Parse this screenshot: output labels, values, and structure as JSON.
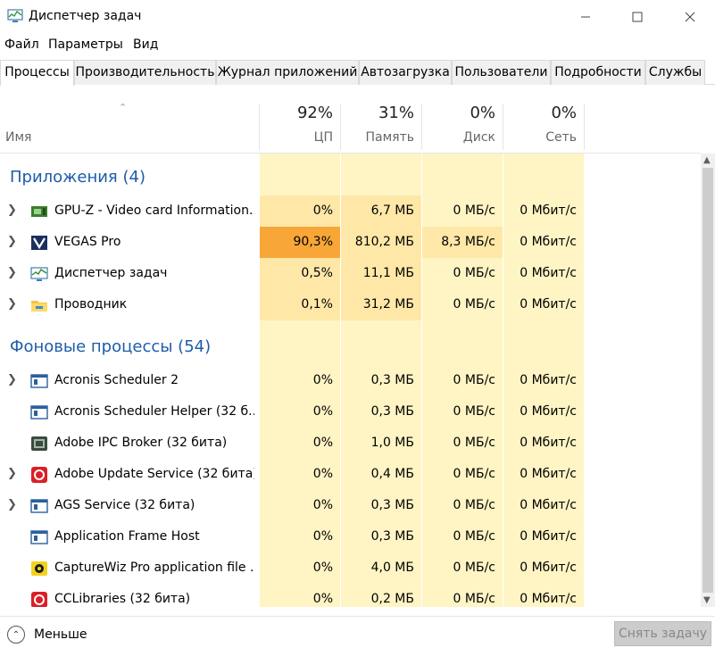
{
  "window": {
    "title": "Диспетчер задач"
  },
  "menu": [
    "Файл",
    "Параметры",
    "Вид"
  ],
  "tabs": [
    "Процессы",
    "Производительность",
    "Журнал приложений",
    "Автозагрузка",
    "Пользователи",
    "Подробности",
    "Службы"
  ],
  "columns": {
    "name": "Имя",
    "cpu": {
      "pct": "92%",
      "label": "ЦП"
    },
    "mem": {
      "pct": "31%",
      "label": "Память"
    },
    "disk": {
      "pct": "0%",
      "label": "Диск"
    },
    "net": {
      "pct": "0%",
      "label": "Сеть"
    }
  },
  "groups": [
    {
      "title": "Приложения (4)"
    },
    {
      "title": "Фоновые процессы (54)"
    }
  ],
  "rows": [
    {
      "name": "GPU-Z - Video card Information...",
      "cpu": "0%",
      "mem": "6,7 МБ",
      "disk": "0 МБ/с",
      "net": "0 Мбит/с",
      "icon": "gpu-card-icon"
    },
    {
      "name": "VEGAS Pro",
      "cpu": "90,3%",
      "mem": "810,2 МБ",
      "disk": "8,3 МБ/с",
      "net": "0 Мбит/с",
      "icon": "vegas-icon"
    },
    {
      "name": "Диспетчер задач",
      "cpu": "0,5%",
      "mem": "11,1 МБ",
      "disk": "0 МБ/с",
      "net": "0 Мбит/с",
      "icon": "task-manager-icon"
    },
    {
      "name": "Проводник",
      "cpu": "0,1%",
      "mem": "31,2 МБ",
      "disk": "0 МБ/с",
      "net": "0 Мбит/с",
      "icon": "folder-icon"
    },
    {
      "name": "Acronis Scheduler 2",
      "cpu": "0%",
      "mem": "0,3 МБ",
      "disk": "0 МБ/с",
      "net": "0 Мбит/с",
      "icon": "app-window-icon"
    },
    {
      "name": "Acronis Scheduler Helper (32 б...",
      "cpu": "0%",
      "mem": "0,3 МБ",
      "disk": "0 МБ/с",
      "net": "0 Мбит/с",
      "icon": "app-window-icon"
    },
    {
      "name": "Adobe IPC Broker (32 бита)",
      "cpu": "0%",
      "mem": "1,0 МБ",
      "disk": "0 МБ/с",
      "net": "0 Мбит/с",
      "icon": "adobe-ipc-icon"
    },
    {
      "name": "Adobe Update Service (32 бита)",
      "cpu": "0%",
      "mem": "0,4 МБ",
      "disk": "0 МБ/с",
      "net": "0 Мбит/с",
      "icon": "adobe-cc-icon"
    },
    {
      "name": "AGS Service (32 бита)",
      "cpu": "0%",
      "mem": "0,3 МБ",
      "disk": "0 МБ/с",
      "net": "0 Мбит/с",
      "icon": "app-window-icon"
    },
    {
      "name": "Application Frame Host",
      "cpu": "0%",
      "mem": "0,3 МБ",
      "disk": "0 МБ/с",
      "net": "0 Мбит/с",
      "icon": "app-window-icon"
    },
    {
      "name": "CaptureWiz Pro application file ...",
      "cpu": "0%",
      "mem": "4,0 МБ",
      "disk": "0 МБ/с",
      "net": "0 Мбит/с",
      "icon": "capturewiz-icon"
    },
    {
      "name": "CCLibraries (32 бита)",
      "cpu": "0%",
      "mem": "0,2 МБ",
      "disk": "0 МБ/с",
      "net": "0 Мбит/с",
      "icon": "adobe-cc-icon"
    }
  ],
  "footer": {
    "less": "Меньше",
    "end_task": "Снять задачу"
  }
}
